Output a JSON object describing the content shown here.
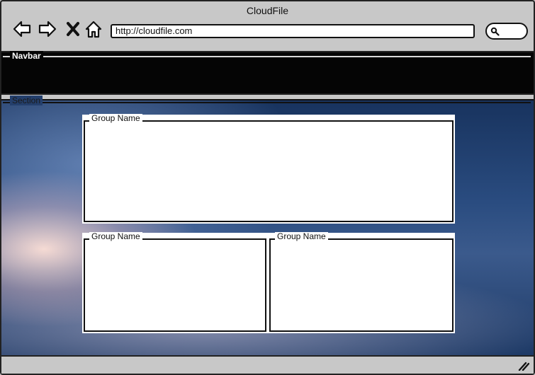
{
  "window": {
    "title": "CloudFile"
  },
  "toolbar": {
    "back_icon": "back-arrow-icon",
    "forward_icon": "forward-arrow-icon",
    "stop_icon": "close-icon",
    "home_icon": "home-icon",
    "url": "http://cloudfile.com",
    "search_icon": "search-icon"
  },
  "navbar": {
    "label": "Navbar"
  },
  "section": {
    "label": "Section",
    "groups": [
      {
        "name": "Group Name"
      },
      {
        "name": "Group Name"
      },
      {
        "name": "Group Name"
      }
    ]
  },
  "colors": {
    "chrome": "#c8c8c8",
    "navbar_bg": "#050505",
    "panel_bg": "#ffffff",
    "outline": "#111111"
  }
}
